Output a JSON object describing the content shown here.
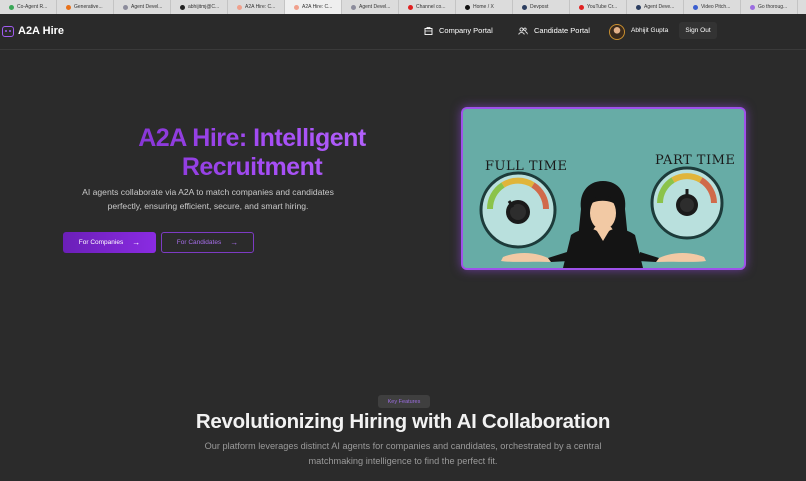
{
  "browser": {
    "tabs": [
      {
        "label": "Co-Agent R...",
        "color": "#3aa757"
      },
      {
        "label": "Generative...",
        "color": "#e8711a"
      },
      {
        "label": "Agent Devel...",
        "color": "#8c8c9c"
      },
      {
        "label": "abhijitmj@C...",
        "color": "#222222"
      },
      {
        "label": "A2A Hire: C...",
        "color": "#f0a08c"
      },
      {
        "label": "A2A Hire: C...",
        "color": "#f0a08c",
        "active": true
      },
      {
        "label": "Agent Devel...",
        "color": "#8c8c9c"
      },
      {
        "label": "Channel co...",
        "color": "#e02020"
      },
      {
        "label": "Home / X",
        "color": "#111111"
      },
      {
        "label": "Devpost",
        "color": "#2c3e60"
      },
      {
        "label": "YouTube Cr...",
        "color": "#e02020"
      },
      {
        "label": "Agent Deve...",
        "color": "#2c3e60"
      },
      {
        "label": "Video Pitch...",
        "color": "#3b5fd0"
      },
      {
        "label": "Go thoroug...",
        "color": "#9b6de0"
      }
    ]
  },
  "nav": {
    "brand": "A2A Hire",
    "company_portal": "Company Portal",
    "candidate_portal": "Candidate Portal",
    "user_name": "Abhijit Gupta",
    "sign_out": "Sign Out"
  },
  "hero": {
    "title_line1": "A2A Hire: Intelligent",
    "title_line2": "Recruitment",
    "description": "AI agents collaborate via A2A to match companies and candidates perfectly, ensuring efficient, secure, and smart hiring.",
    "btn_companies": "For Companies",
    "btn_candidates": "For Candidates",
    "illustration": {
      "left_label": "FULL TIME",
      "right_label": "PART TIME"
    }
  },
  "features": {
    "badge": "Key Features",
    "title": "Revolutionizing Hiring with AI Collaboration",
    "description": "Our platform leverages distinct AI agents for companies and candidates, orchestrated by a central matchmaking intelligence to find the perfect fit."
  },
  "colors": {
    "accent": "#8a2be2",
    "background": "#2b2b2b",
    "illustration_bg": "#67aca6"
  }
}
